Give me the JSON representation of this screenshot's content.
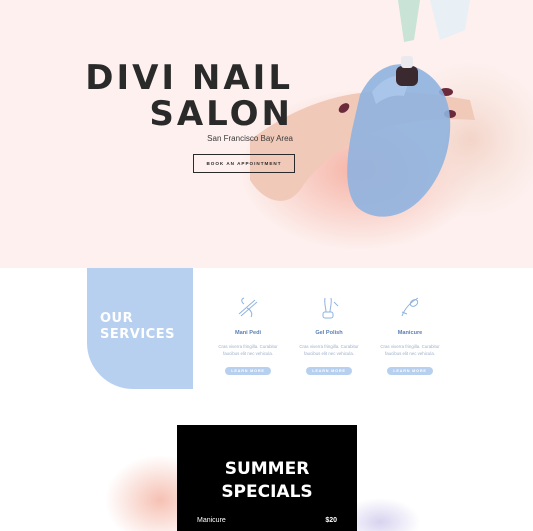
{
  "hero": {
    "title_line1": "DIVI NAIL",
    "title_line2": "SALON",
    "subtitle": "San Francisco Bay Area",
    "cta_label": "BOOK AN APPOINTMENT",
    "background_color": "#fdf0ee"
  },
  "services": {
    "heading_line1": "OUR",
    "heading_line2": "SERVICES",
    "panel_color": "#b8d0ef",
    "items": [
      {
        "icon": "nail-file-icon",
        "name": "Mani Pedi",
        "description": "Cras viverra fringilla. Curabitur faucibus elit nec vehicula.",
        "button": "LEARN MORE"
      },
      {
        "icon": "nail-polish-icon",
        "name": "Gel Polish",
        "description": "Cras viverra fringilla. Curabitur faucibus elit nec vehicula.",
        "button": "LEARN MORE"
      },
      {
        "icon": "manicure-icon",
        "name": "Manicure",
        "description": "Cras viverra fringilla. Curabitur faucibus elit nec vehicula.",
        "button": "LEARN MORE"
      }
    ]
  },
  "specials": {
    "title_line1": "SUMMER",
    "title_line2": "SPECIALS",
    "items": [
      {
        "name": "Manicure",
        "price": "$20"
      }
    ]
  }
}
